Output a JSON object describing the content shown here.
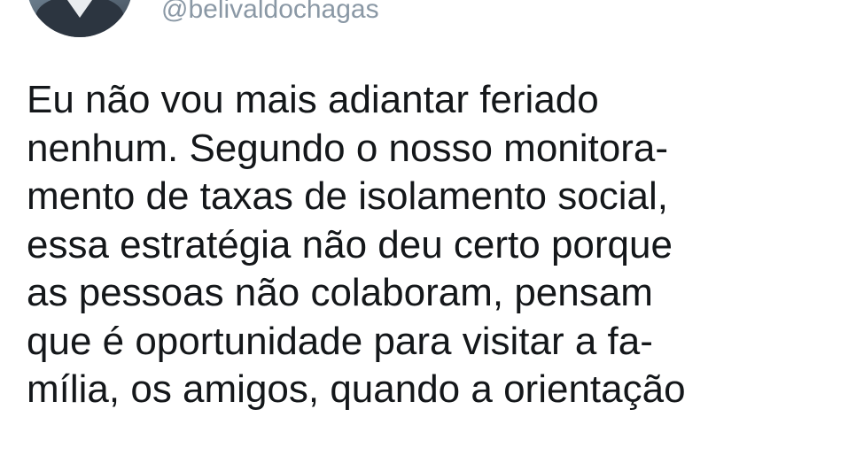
{
  "tweet": {
    "handle": "@belivaldochagas",
    "lines": [
      "Eu não vou mais adiantar feriado",
      "nenhum. Segundo o nosso monitora-",
      "mento de taxas de isolamento social,",
      "essa estratégia não deu certo porque",
      "as pessoas não colaboram, pensam",
      "que é oportunidade para visitar a fa-",
      "mília, os amigos, quando a orientação"
    ]
  },
  "colors": {
    "text": "#14171a",
    "handle": "#8a98a5",
    "background": "#ffffff"
  }
}
